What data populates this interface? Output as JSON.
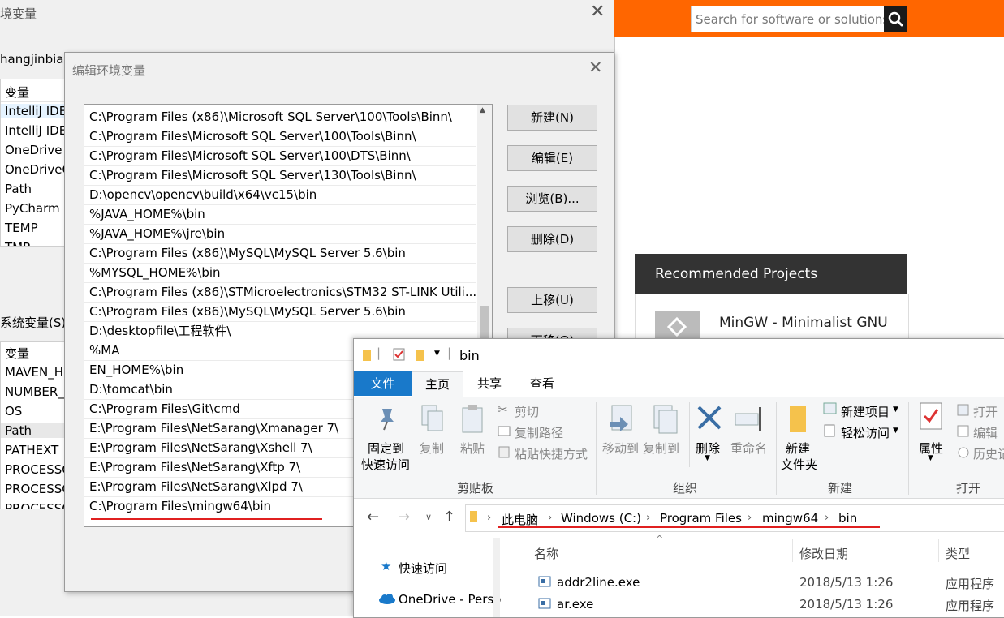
{
  "env_dialog": {
    "title": "境变量",
    "user_label": "hangjinbiao",
    "user_vars_header": "变量",
    "user_vars": [
      "IntelliJ IDE",
      "IntelliJ IDE",
      "OneDrive",
      "OneDriveC",
      "Path",
      "PyCharm C",
      "TEMP",
      "TMP"
    ],
    "system_label": "系统变量(S)",
    "system_vars_header": "变量",
    "system_vars": [
      "MAVEN_H",
      "NUMBER_",
      "OS",
      "Path",
      "PATHEXT",
      "PROCESSO",
      "PROCESSO",
      "PROCESSO"
    ]
  },
  "edit_dialog": {
    "title": "编辑环境变量",
    "paths": [
      "C:\\Program Files (x86)\\Microsoft SQL Server\\100\\Tools\\Binn\\",
      "C:\\Program Files\\Microsoft SQL Server\\100\\Tools\\Binn\\",
      "C:\\Program Files\\Microsoft SQL Server\\100\\DTS\\Binn\\",
      "C:\\Program Files\\Microsoft SQL Server\\130\\Tools\\Binn\\",
      "D:\\opencv\\opencv\\build\\x64\\vc15\\bin",
      "%JAVA_HOME%\\bin",
      "%JAVA_HOME%\\jre\\bin",
      "C:\\Program Files (x86)\\MySQL\\MySQL Server 5.6\\bin",
      "%MYSQL_HOME%\\bin",
      "C:\\Program Files (x86)\\STMicroelectronics\\STM32 ST-LINK Utili...",
      "C:\\Program Files (x86)\\MySQL\\MySQL Server 5.6\\bin",
      "D:\\desktopfile\\工程软件\\",
      "%MA",
      "EN_HOME%\\bin",
      "D:\\tomcat\\bin",
      "C:\\Program Files\\Git\\cmd",
      "E:\\Program Files\\NetSarang\\Xmanager 7\\",
      "E:\\Program Files\\NetSarang\\Xshell 7\\",
      "E:\\Program Files\\NetSarang\\Xftp 7\\",
      "E:\\Program Files\\NetSarang\\Xlpd 7\\",
      "C:\\Program Files\\mingw64\\bin"
    ],
    "buttons": {
      "new": "新建(N)",
      "edit": "编辑(E)",
      "browse": "浏览(B)...",
      "delete": "删除(D)",
      "move_up": "上移(U)",
      "move_down": "下移(O)"
    }
  },
  "website": {
    "search_placeholder": "Search for software or solutions",
    "recommended_header": "Recommended Projects",
    "recommended_item": "MinGW - Minimalist GNU",
    "accent_color": "#ff6600"
  },
  "explorer": {
    "title": "bin",
    "tabs": [
      "文件",
      "主页",
      "共享",
      "查看"
    ],
    "ribbon": {
      "pin": [
        "固定到",
        "快速访问"
      ],
      "copy": "复制",
      "paste": "粘贴",
      "cut": "剪切",
      "copy_path": "复制路径",
      "paste_shortcut": "粘贴快捷方式",
      "group_clipboard": "剪贴板",
      "move_to": "移动到",
      "copy_to": "复制到",
      "delete": "删除",
      "rename": "重命名",
      "group_organize": "组织",
      "new_folder": [
        "新建",
        "文件夹"
      ],
      "new_item": "新建项目",
      "easy_access": "轻松访问",
      "group_new": "新建",
      "properties": "属性",
      "open": "打开",
      "edit": "编辑",
      "history": "历史记",
      "group_open": "打开"
    },
    "breadcrumb": [
      "此电脑",
      "Windows (C:)",
      "Program Files",
      "mingw64",
      "bin"
    ],
    "nav": [
      "快速访问",
      "OneDrive - Perso"
    ],
    "columns": [
      "名称",
      "修改日期",
      "类型"
    ],
    "files": [
      {
        "name": "addr2line.exe",
        "date": "2018/5/13 1:26",
        "type": "应用程序"
      },
      {
        "name": "ar.exe",
        "date": "2018/5/13 1:26",
        "type": "应用程序"
      }
    ]
  }
}
